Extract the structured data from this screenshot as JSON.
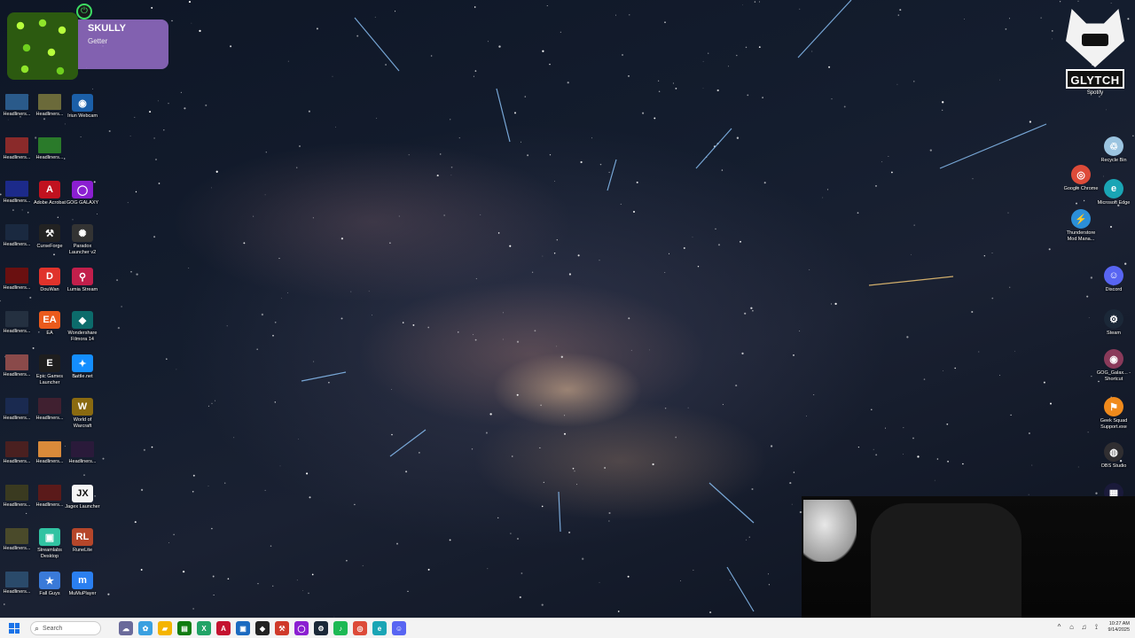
{
  "notification": {
    "name": "SKULLY",
    "subtitle": "Getter"
  },
  "glytch_logo": {
    "word": "GLYTCH",
    "label": "Spotify"
  },
  "left_icons": [
    {
      "label": "Headliners...",
      "color": "#2a5a8a",
      "kind": "thumb"
    },
    {
      "label": "Headliners...",
      "color": "#6b6a3a",
      "kind": "thumb"
    },
    {
      "label": "Iriun Webcam",
      "color": "#1b5fa8",
      "kind": "app",
      "glyph": "◉"
    },
    {
      "label": "Headliners...",
      "color": "#8a2a2a",
      "kind": "thumb"
    },
    {
      "label": "Headliners...",
      "color": "#2a7a2a",
      "kind": "thumb"
    },
    {
      "label": "Headliners...",
      "color": "#1c2a8a",
      "kind": "thumb"
    },
    {
      "label": "Adobe Acrobat",
      "color": "#c1121f",
      "kind": "app",
      "glyph": "A"
    },
    {
      "label": "GOG GALAXY",
      "color": "#8b1fd1",
      "kind": "app",
      "glyph": "◯"
    },
    {
      "label": "Headliners...",
      "color": "#1a2940",
      "kind": "thumb"
    },
    {
      "label": "CurseForge",
      "color": "#222222",
      "kind": "app",
      "glyph": "⚒"
    },
    {
      "label": "Paradox Launcher v2",
      "color": "#333333",
      "kind": "app",
      "glyph": "✺"
    },
    {
      "label": "Headliners...",
      "color": "#6a1010",
      "kind": "thumb"
    },
    {
      "label": "DouWan",
      "color": "#e0332b",
      "kind": "app",
      "glyph": "D"
    },
    {
      "label": "Lumia Stream",
      "color": "#c21f4b",
      "kind": "app",
      "glyph": "⚲"
    },
    {
      "label": "Headliners...",
      "color": "#243040",
      "kind": "thumb"
    },
    {
      "label": "EA",
      "color": "#ea5a1c",
      "kind": "app",
      "glyph": "EA"
    },
    {
      "label": "Wondershare Filmora 14",
      "color": "#0c6b6b",
      "kind": "app",
      "glyph": "◆"
    },
    {
      "label": "Headliners...",
      "color": "#8a4a4a",
      "kind": "thumb"
    },
    {
      "label": "Epic Games Launcher",
      "color": "#1e1e1e",
      "kind": "app",
      "glyph": "E"
    },
    {
      "label": "Battle.net",
      "color": "#148eff",
      "kind": "app",
      "glyph": "✦"
    },
    {
      "label": "Headliners...",
      "color": "#1a2a50",
      "kind": "thumb"
    },
    {
      "label": "Headliners...",
      "color": "#402030",
      "kind": "thumb"
    },
    {
      "label": "World of Warcraft",
      "color": "#8a6a10",
      "kind": "app",
      "glyph": "W"
    },
    {
      "label": "Headliners...",
      "color": "#4a2020",
      "kind": "thumb"
    },
    {
      "label": "Headliners...",
      "color": "#d98a3a",
      "kind": "thumb"
    },
    {
      "label": "Headliners...",
      "color": "#2a1a3a",
      "kind": "thumb"
    },
    {
      "label": "Headliners...",
      "color": "#3a3a20",
      "kind": "thumb"
    },
    {
      "label": "Headliners...",
      "color": "#5a1a1a",
      "kind": "thumb"
    },
    {
      "label": "Jagex Launcher",
      "color": "#f5f5f5",
      "kind": "app",
      "glyph": "JX"
    },
    {
      "label": "Headliners...",
      "color": "#4a4a2a",
      "kind": "thumb"
    },
    {
      "label": "Streamlabs Desktop",
      "color": "#31c3a2",
      "kind": "app",
      "glyph": "▣"
    },
    {
      "label": "RuneLite",
      "color": "#b5462a",
      "kind": "app",
      "glyph": "RL"
    },
    {
      "label": "Headliners...",
      "color": "#2a4a6a",
      "kind": "thumb"
    },
    {
      "label": "Fall Guys",
      "color": "#3a7ad8",
      "kind": "app",
      "glyph": "★"
    },
    {
      "label": "MuMuPlayer",
      "color": "#2a7ff0",
      "kind": "app",
      "glyph": "m"
    }
  ],
  "right_icons": [
    {
      "label": "Recycle Bin",
      "color": "#9bc4e0",
      "glyph": "♲"
    },
    {
      "label": "Google Chrome",
      "color": "#dd4b39",
      "glyph": "◎"
    },
    {
      "label": "Microsoft Edge",
      "color": "#1aa5b5",
      "glyph": "e"
    },
    {
      "label": "Thunderstore Mod Mana...",
      "color": "#2b8fd8",
      "glyph": "⚡"
    },
    {
      "label": "Discord",
      "color": "#5865f2",
      "glyph": "☺"
    },
    {
      "label": "Steam",
      "color": "#1b2838",
      "glyph": "⚙"
    },
    {
      "label": "GOG_Galax... - Shortcut",
      "color": "#8a3a5a",
      "glyph": "◉"
    },
    {
      "label": "Geek Squad Support.exe",
      "color": "#f08a1c",
      "glyph": "⚑"
    },
    {
      "label": "OBS Studio",
      "color": "#302e31",
      "glyph": "◍"
    },
    {
      "label": "Stream Deck",
      "color": "#1a1a3a",
      "glyph": "▦"
    }
  ],
  "taskbar": {
    "search_placeholder": "Search",
    "pinned": [
      {
        "name": "widgets",
        "color": "#6a6a9a",
        "glyph": "☁"
      },
      {
        "name": "copilot",
        "color": "#3aa0e0",
        "glyph": "✿"
      },
      {
        "name": "file-explorer",
        "color": "#f4b400",
        "glyph": "▰"
      },
      {
        "name": "xbox",
        "color": "#107c10",
        "glyph": "▤"
      },
      {
        "name": "excel",
        "color": "#21a366",
        "glyph": "X"
      },
      {
        "name": "app-red",
        "color": "#c4122f",
        "glyph": "A"
      },
      {
        "name": "app-blue",
        "color": "#1a6ac0",
        "glyph": "▣"
      },
      {
        "name": "epic-games",
        "color": "#222222",
        "glyph": "◆"
      },
      {
        "name": "curseforge",
        "color": "#cf3a2a",
        "glyph": "⚒"
      },
      {
        "name": "gog-galaxy",
        "color": "#8b1fd1",
        "glyph": "◯"
      },
      {
        "name": "steam",
        "color": "#1b2838",
        "glyph": "⚙"
      },
      {
        "name": "spotify",
        "color": "#1db954",
        "glyph": "♪"
      },
      {
        "name": "chrome",
        "color": "#dd4b39",
        "glyph": "◎"
      },
      {
        "name": "edge",
        "color": "#1aa5b5",
        "glyph": "e"
      },
      {
        "name": "discord",
        "color": "#5865f2",
        "glyph": "☺"
      }
    ],
    "tray": [
      "^",
      "⌂",
      "♫",
      "⟟"
    ],
    "time": "10:27 AM",
    "date": "9/14/2025"
  }
}
